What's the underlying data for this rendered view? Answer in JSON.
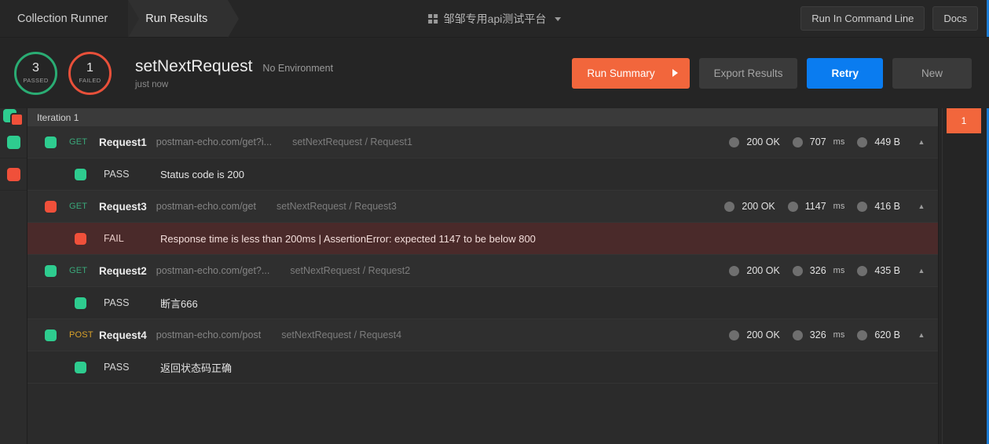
{
  "topbar": {
    "tabs": [
      {
        "label": "Collection Runner",
        "active": false
      },
      {
        "label": "Run Results",
        "active": true
      }
    ],
    "workspace": "邹邹专用api测试平台",
    "workspace_icon": "grid-icon",
    "workspace_caret": "chevron-down-icon",
    "run_in_command_line": "Run In Command Line",
    "docs": "Docs"
  },
  "summary": {
    "passed_count": "3",
    "passed_label": "PASSED",
    "failed_count": "1",
    "failed_label": "FAILED",
    "run_title": "setNextRequest",
    "environment": "No Environment",
    "timestamp": "just now",
    "buttons": {
      "run_summary": "Run Summary",
      "export_results": "Export Results",
      "retry": "Retry",
      "new": "New"
    },
    "colors": {
      "pass_ring": "#2aac73",
      "fail_ring": "#e8503a",
      "orange": "#f2663c",
      "blue": "#0a7cf0"
    }
  },
  "iteration": {
    "header": "Iteration 1",
    "badge": "1"
  },
  "rows": [
    {
      "kind": "request",
      "status": "pass",
      "method": "GET",
      "name": "Request1",
      "url": "postman-echo.com/get?i...",
      "path": "setNextRequest / Request1",
      "code": "200 OK",
      "time": "707",
      "time_unit": "ms",
      "size": "449 B",
      "chevron": "chevron-up-icon"
    },
    {
      "kind": "assertion",
      "status": "pass",
      "label": "PASS",
      "text": "Status code is 200"
    },
    {
      "kind": "request",
      "status": "fail",
      "method": "GET",
      "name": "Request3",
      "url": "postman-echo.com/get",
      "path": "setNextRequest / Request3",
      "code": "200 OK",
      "time": "1147",
      "time_unit": "ms",
      "size": "416 B",
      "chevron": "chevron-up-icon"
    },
    {
      "kind": "assertion",
      "status": "fail",
      "label": "FAIL",
      "text": "Response time is less than 200ms | AssertionError: expected 1147 to be below 800"
    },
    {
      "kind": "request",
      "status": "pass",
      "method": "GET",
      "name": "Request2",
      "url": "postman-echo.com/get?...",
      "path": "setNextRequest / Request2",
      "code": "200 OK",
      "time": "326",
      "time_unit": "ms",
      "size": "435 B",
      "chevron": "chevron-up-icon"
    },
    {
      "kind": "assertion",
      "status": "pass",
      "label": "PASS",
      "text": "断言666"
    },
    {
      "kind": "request",
      "status": "pass",
      "method": "POST",
      "name": "Request4",
      "url": "postman-echo.com/post",
      "path": "setNextRequest / Request4",
      "code": "200 OK",
      "time": "326",
      "time_unit": "ms",
      "size": "620 B",
      "chevron": "chevron-up-icon"
    },
    {
      "kind": "assertion",
      "status": "pass",
      "label": "PASS",
      "text": "返回状态码正确"
    }
  ]
}
